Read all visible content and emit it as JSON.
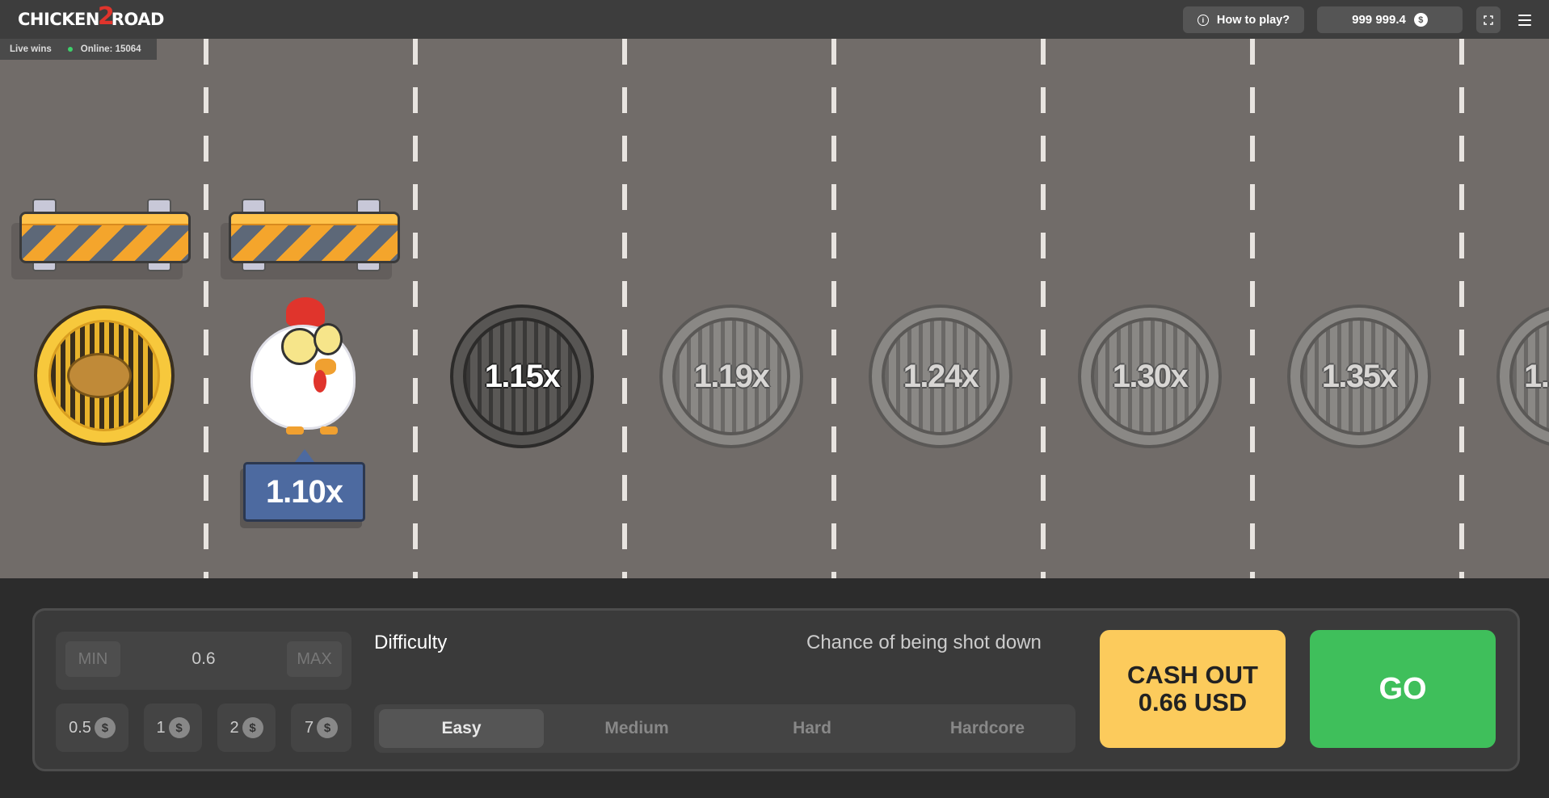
{
  "header": {
    "logo_part1": "CHICKEN",
    "logo_part2": "2",
    "logo_part3": "ROAD",
    "howto_label": "How to play?",
    "balance": "999 999.4",
    "currency_symbol": "$"
  },
  "live": {
    "live_wins_label": "Live wins",
    "online_label": "Online: 15064"
  },
  "game": {
    "current_multiplier": "1.10x",
    "multipliers": [
      "1.15x",
      "1.19x",
      "1.24x",
      "1.30x",
      "1.35x",
      "1."
    ]
  },
  "bet": {
    "min_label": "MIN",
    "max_label": "MAX",
    "value": "0.6",
    "chips": [
      "0.5",
      "1",
      "2",
      "7"
    ],
    "chip_currency": "$"
  },
  "difficulty": {
    "label": "Difficulty",
    "chance_label": "Chance of being shot down",
    "options": [
      "Easy",
      "Medium",
      "Hard",
      "Hardcore"
    ],
    "selected": "Easy"
  },
  "actions": {
    "cashout_line1": "CASH OUT",
    "cashout_line2": "0.66 USD",
    "go_label": "GO"
  },
  "colors": {
    "road": "#716c69",
    "cashout": "#fccb5c",
    "go": "#3fbf5b",
    "current_tag": "#4d6aa0"
  }
}
